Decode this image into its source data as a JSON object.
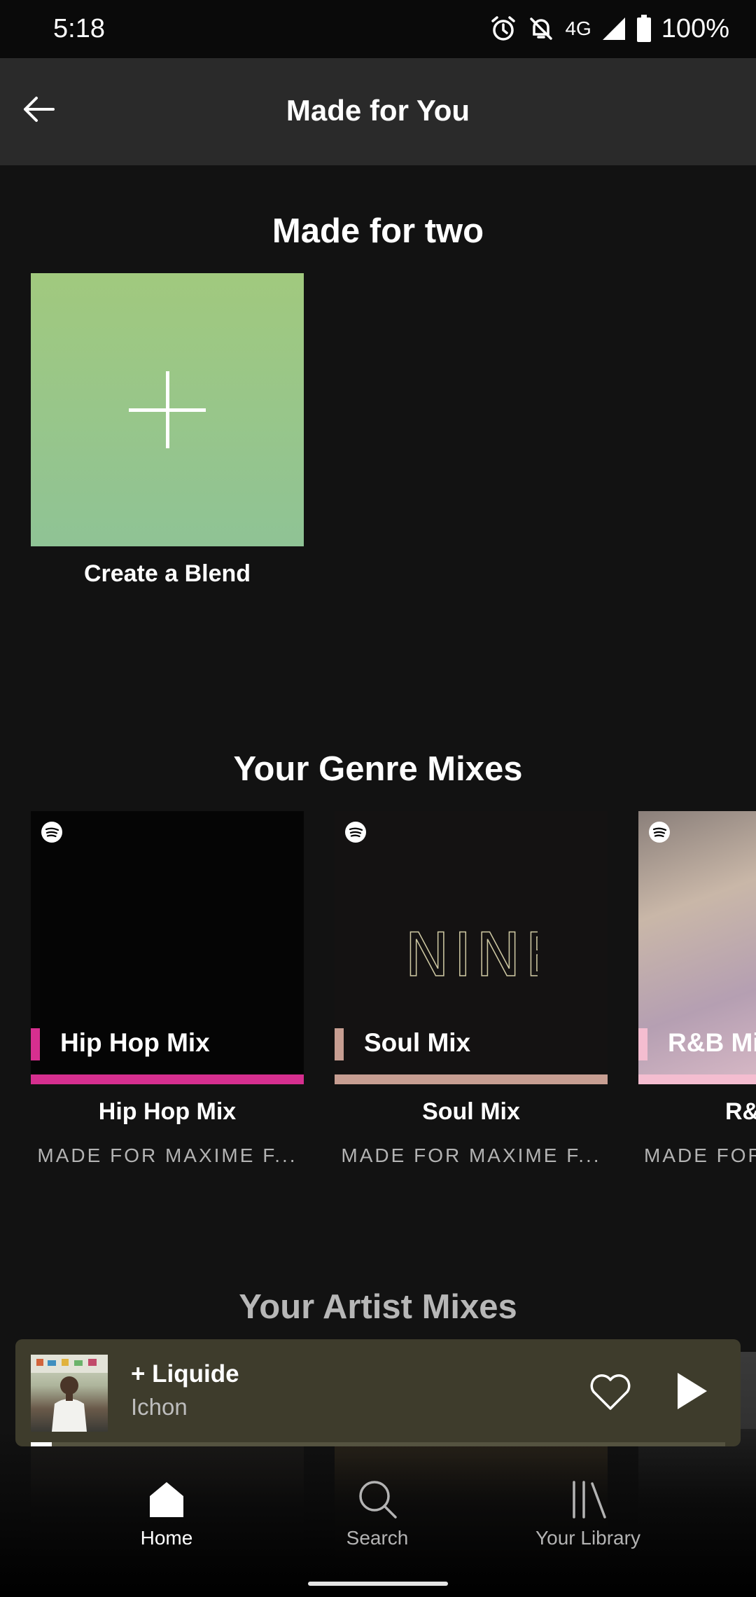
{
  "status_bar": {
    "time": "5:18",
    "network": "4G",
    "battery": "100%",
    "icons": [
      "alarm-icon",
      "mute-bell-icon",
      "signal-icon",
      "battery-icon"
    ]
  },
  "header": {
    "title": "Made for You",
    "back_icon": "back-arrow-icon"
  },
  "made_for_two": {
    "title": "Made for two",
    "blend": {
      "label": "Create a Blend",
      "icon": "plus-icon"
    }
  },
  "genre_mixes": {
    "title": "Your Genre Mixes",
    "items": [
      {
        "overlay": "Hip Hop Mix",
        "title": "Hip Hop Mix",
        "subtitle": "MADE FOR MAXIME F...",
        "accent": "#d62f8f"
      },
      {
        "overlay": "Soul Mix",
        "title": "Soul Mix",
        "subtitle": "MADE FOR MAXIME F...",
        "accent": "#c79e92",
        "art_text": "NINE"
      },
      {
        "overlay": "R&B Mi",
        "title": "R&",
        "subtitle": "MADE FOR",
        "accent": "#f4bdd0"
      }
    ]
  },
  "artist_mixes": {
    "title": "Your Artist Mixes"
  },
  "now_playing": {
    "track": "+ Liquide",
    "artist": "Ichon",
    "progress": 0.03,
    "icons": [
      "heart-icon",
      "play-icon"
    ]
  },
  "bottom_nav": {
    "items": [
      {
        "label": "Home",
        "icon": "home-icon",
        "active": true
      },
      {
        "label": "Search",
        "icon": "search-icon",
        "active": false
      },
      {
        "label": "Your Library",
        "icon": "library-icon",
        "active": false
      }
    ]
  },
  "colors": {
    "background": "#121212",
    "header": "#2a2a2a",
    "player": "#3e3c2c",
    "blend_gradient_top": "#a1c97e",
    "blend_gradient_bottom": "#8fc395"
  }
}
